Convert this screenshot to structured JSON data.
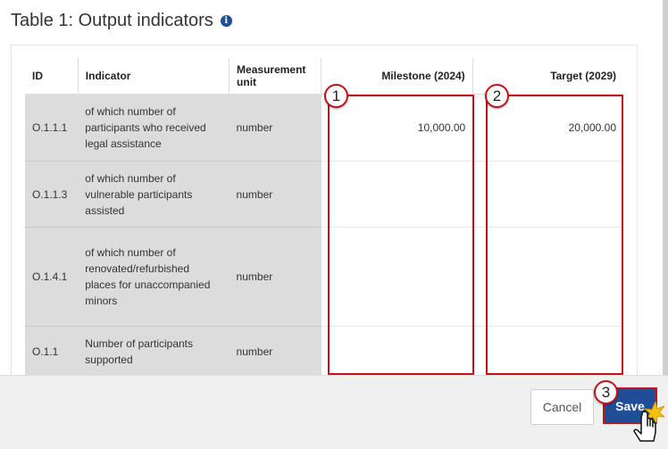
{
  "title": "Table 1: Output indicators",
  "table": {
    "headers": {
      "id": "ID",
      "indicator": "Indicator",
      "unit": "Measurement unit",
      "milestone": "Milestone (2024)",
      "target": "Target (2029)"
    },
    "rows": [
      {
        "id": "O.1.1.1",
        "indicator": "of which number of participants who received legal assistance",
        "unit": "number",
        "milestone": "10,000.00",
        "target": "20,000.00"
      },
      {
        "id": "O.1.1.3",
        "indicator": "of which number of vulnerable participants assisted",
        "unit": "number",
        "milestone": "",
        "target": ""
      },
      {
        "id": "O.1.4.1",
        "indicator": "of which number of renovated/refurbished places for unaccompanied minors",
        "unit": "number",
        "milestone": "",
        "target": ""
      },
      {
        "id": "O.1.1",
        "indicator": "Number of participants supported",
        "unit": "number",
        "milestone": "",
        "target": ""
      }
    ]
  },
  "callouts": [
    "1",
    "2",
    "3"
  ],
  "footer": {
    "cancel_label": "Cancel",
    "save_label": "Save"
  },
  "icons": {
    "info": "info-icon",
    "cursor": "hand-pointer-icon"
  },
  "colors": {
    "highlight": "#c0131b",
    "save_bg": "#1f4d96",
    "grey_cell": "#dcdcdc"
  }
}
